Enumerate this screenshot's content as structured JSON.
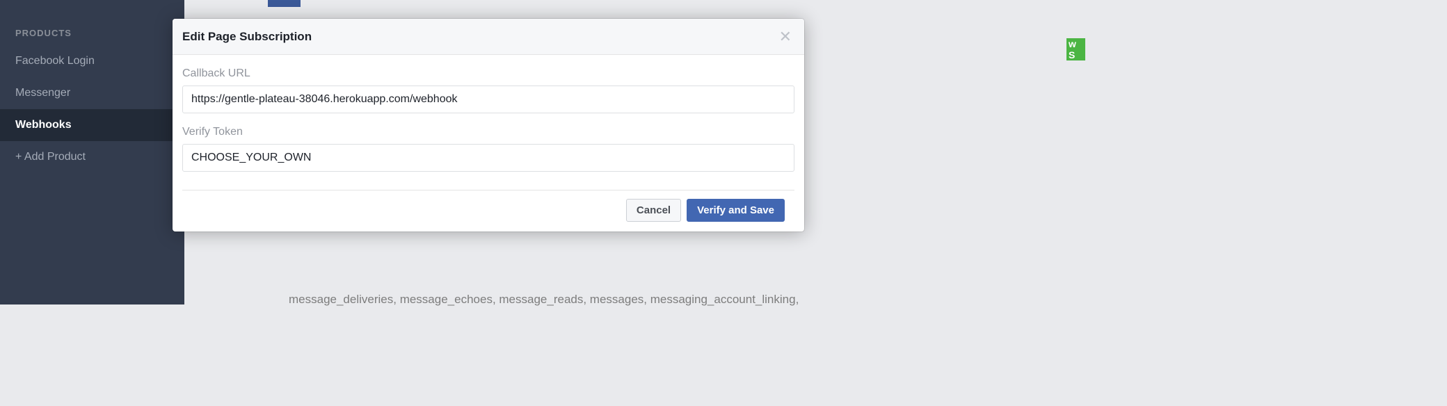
{
  "sidebar": {
    "heading": "PRODUCTS",
    "items": [
      {
        "label": "Facebook Login"
      },
      {
        "label": "Messenger"
      },
      {
        "label": "Webhooks"
      },
      {
        "label": "+ Add Product"
      }
    ]
  },
  "background": {
    "partial_button": "w S",
    "bottom_text": "message_deliveries, message_echoes, message_reads, messages, messaging_account_linking,"
  },
  "modal": {
    "title": "Edit Page Subscription",
    "callback_label": "Callback URL",
    "callback_value": "https://gentle-plateau-38046.herokuapp.com/webhook",
    "verify_label": "Verify Token",
    "verify_value": "CHOOSE_YOUR_OWN",
    "cancel_label": "Cancel",
    "save_label": "Verify and Save"
  }
}
